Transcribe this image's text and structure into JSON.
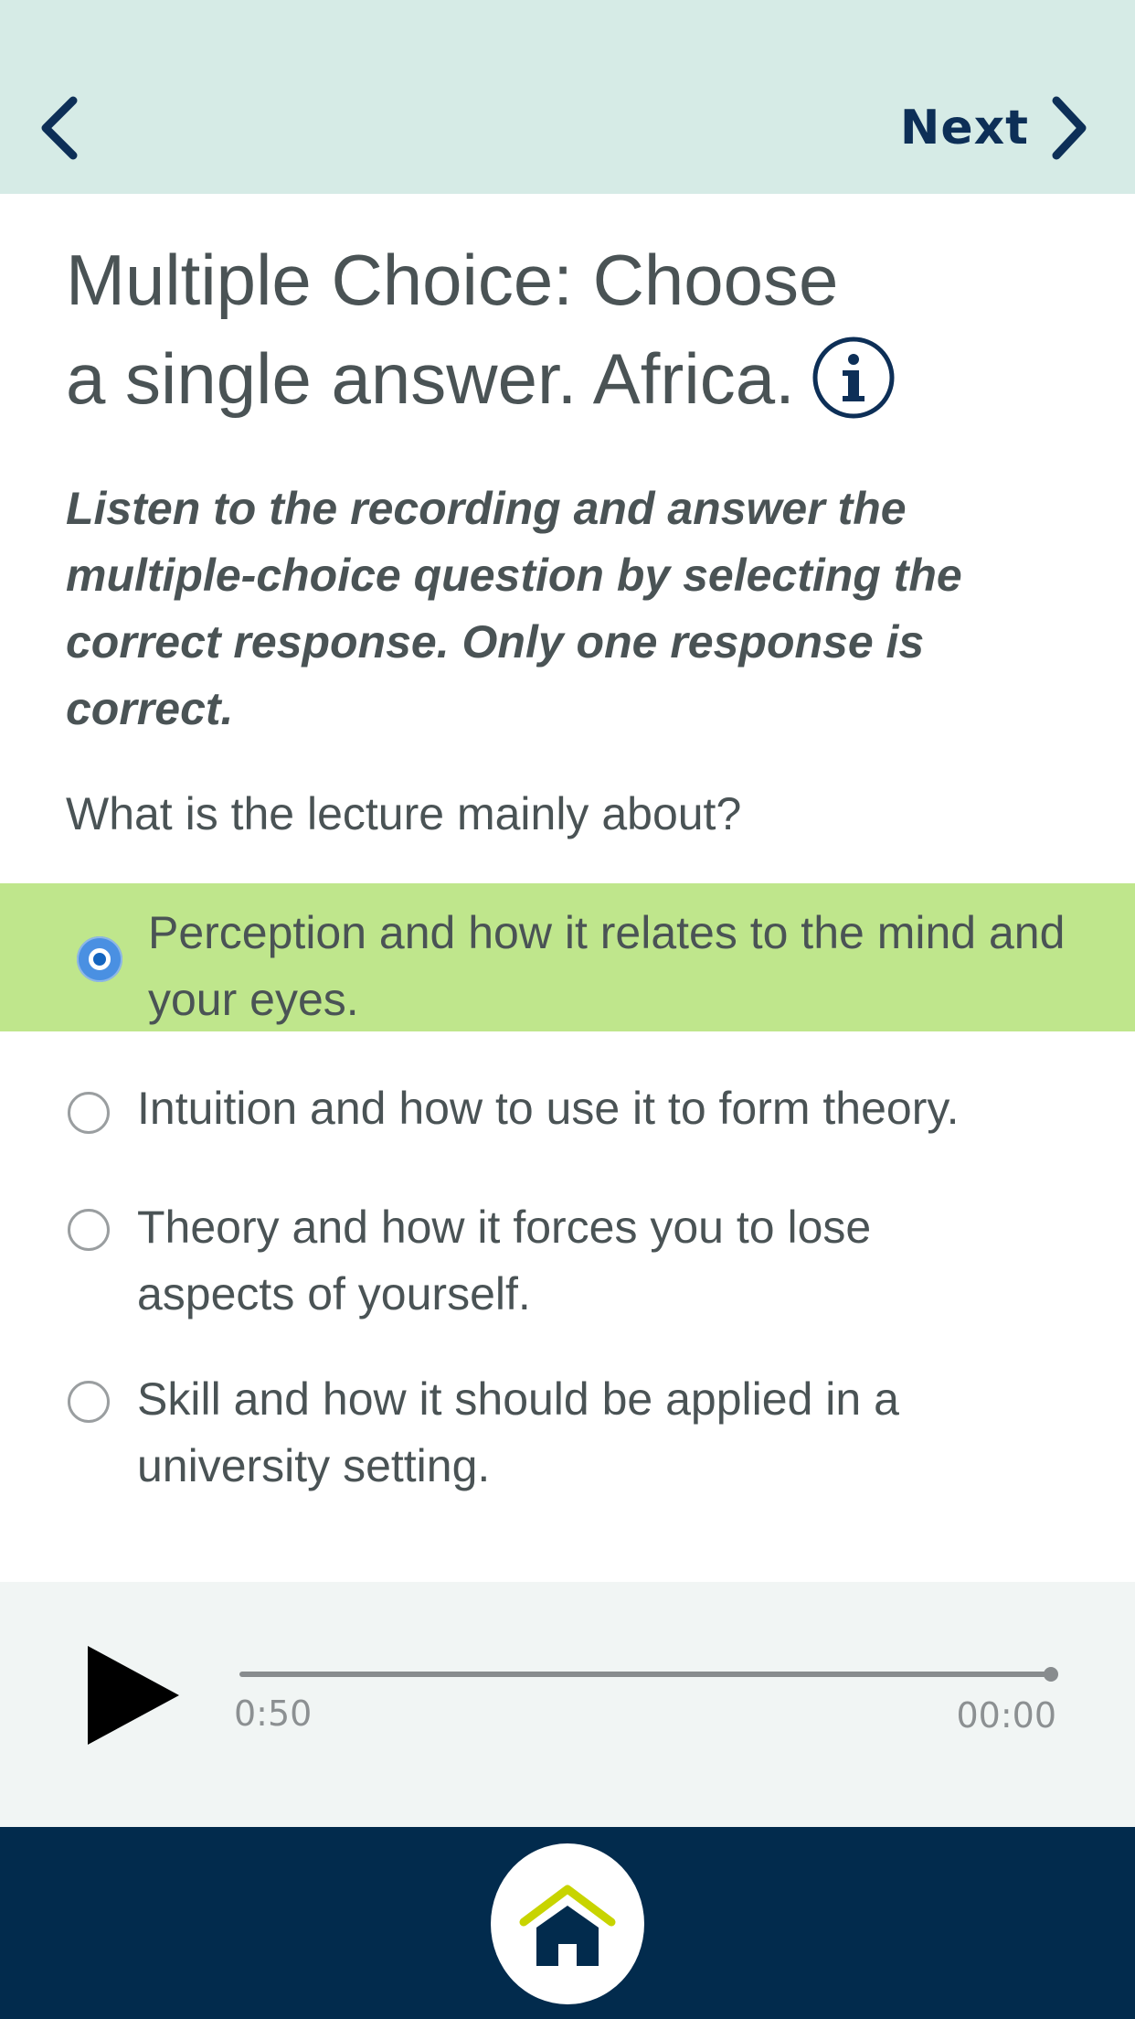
{
  "header": {
    "back_icon": "chevron-left-icon",
    "next_label": "Next",
    "next_icon": "chevron-right-icon"
  },
  "title": {
    "line1": "Multiple Choice: Choose",
    "line2": "a single answer. Africa.",
    "info_icon": "info-icon"
  },
  "instructions": "Listen to the recording and answer the multiple-choice question by selecting the correct response. Only one response is correct.",
  "question": "What is the lecture mainly about?",
  "options": [
    {
      "label": "Perception and how it relates to the mind and your eyes.",
      "selected": true
    },
    {
      "label": "Intuition and how to use it to form theory.",
      "selected": false
    },
    {
      "label": "Theory and how it forces you to lose aspects of yourself.",
      "selected": false
    },
    {
      "label": "Skill and how it should be applied in a university setting.",
      "selected": false
    }
  ],
  "player": {
    "play_icon": "play-icon",
    "time_left": "0:50",
    "time_right": "00:00",
    "progress": 1.0
  },
  "footer": {
    "home_icon": "home-icon"
  },
  "colors": {
    "header_bg": "#d6ebe6",
    "brand_navy": "#0d2f57",
    "selected_bg": "#bfe68c",
    "footer_bg": "#022b4d",
    "home_roof_accent": "#c8d400"
  }
}
